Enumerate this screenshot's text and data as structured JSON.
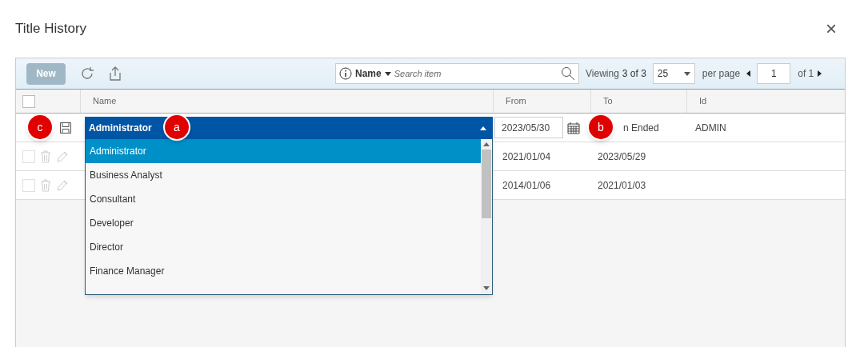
{
  "dialog": {
    "title": "Title History",
    "close": "×"
  },
  "toolbar": {
    "new_button": {
      "label": "New",
      "disabled": true
    },
    "search": {
      "field": "Name",
      "placeholder": "Search item"
    },
    "viewing": "Viewing",
    "viewing_count": "3 of 3",
    "page_size": "25",
    "per_page": "per page",
    "page": "1",
    "of_pages": "of 1"
  },
  "table": {
    "select_all": {
      "checked": false
    },
    "columns": [
      "Name",
      "From",
      "To",
      "Id"
    ],
    "rows": [
      {
        "editing": true,
        "from": "2023/05/30",
        "to": "n Ended",
        "id": "ADMIN"
      },
      {
        "editing": false,
        "checked": false,
        "from": "2021/01/04",
        "to": "2023/05/29",
        "id": ""
      },
      {
        "editing": false,
        "checked": false,
        "from": "2014/01/06",
        "to": "2021/01/03",
        "id": ""
      }
    ]
  },
  "dropdown": {
    "value": "Administrator",
    "options": [
      {
        "label": "Administrator",
        "selected": true
      },
      {
        "label": "Business Analyst",
        "selected": false
      },
      {
        "label": "Consultant",
        "selected": false
      },
      {
        "label": "Developer",
        "selected": false
      },
      {
        "label": "Director",
        "selected": false
      },
      {
        "label": "Finance Manager",
        "selected": false
      }
    ]
  },
  "callouts": [
    {
      "label": "c"
    },
    {
      "label": "a"
    },
    {
      "label": "b"
    }
  ]
}
